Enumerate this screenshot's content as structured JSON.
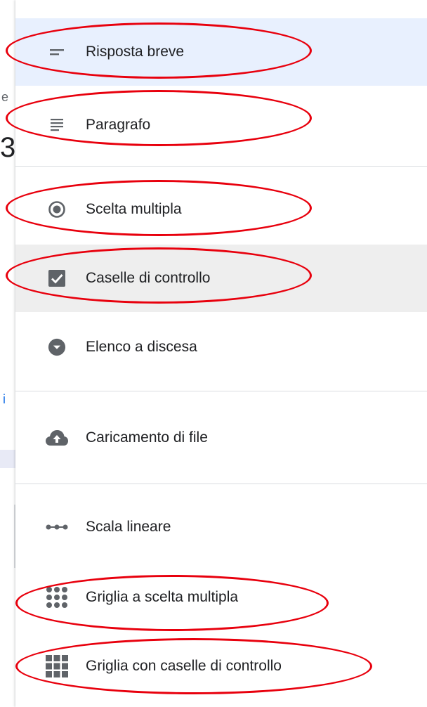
{
  "background": {
    "fragment_top": "e",
    "fragment_big": "3",
    "fragment_link": "i"
  },
  "menu": {
    "items": [
      {
        "label": "Risposta breve",
        "icon": "short-answer-icon"
      },
      {
        "label": "Paragrafo",
        "icon": "paragraph-icon"
      },
      {
        "label": "Scelta multipla",
        "icon": "radio-button-icon"
      },
      {
        "label": "Caselle di controllo",
        "icon": "checkbox-icon"
      },
      {
        "label": "Elenco a discesa",
        "icon": "dropdown-icon"
      },
      {
        "label": "Caricamento di file",
        "icon": "cloud-upload-icon"
      },
      {
        "label": "Scala lineare",
        "icon": "linear-scale-icon"
      },
      {
        "label": "Griglia a scelta multipla",
        "icon": "multiple-choice-grid-icon"
      },
      {
        "label": "Griglia con caselle di controllo",
        "icon": "checkbox-grid-icon"
      }
    ]
  },
  "colors": {
    "selected_background": "#e8f0fe",
    "hover_background": "#eeeeee",
    "icon_color": "#5f6368",
    "annotation_red": "#e8000d"
  }
}
